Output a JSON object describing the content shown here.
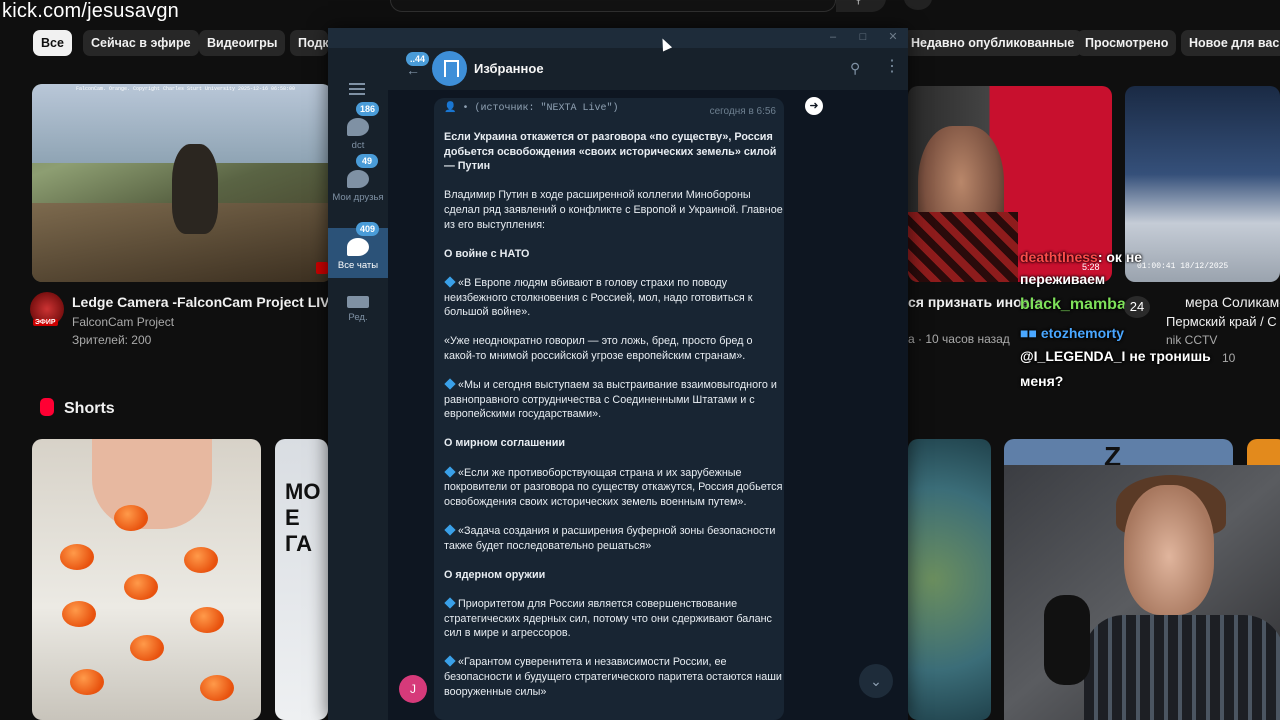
{
  "overlay_url": "kick.com/jesusavgn",
  "chips": [
    "Все",
    "Сейчас в эфире",
    "Видеоигры",
    "Подк",
    "Недавно опубликованные",
    "Просмотрено",
    "Новое для вас"
  ],
  "falcon_video": {
    "caption": "FalconCam. Orange. Copyright Charles Sturt University 2025-12-16 06:58:00",
    "title": "Ledge Camera -FalconCam Project LIVE",
    "channel": "FalconCam Project",
    "viewers": "Зрителей: 200",
    "live_badge": "ЭФИР"
  },
  "right_video_meta": "а · 10 часов назад",
  "right_video_title_frag": "ся признать иноаге",
  "snow_video": {
    "meta": "01:00:41 18/12/2025",
    "title": "мера Соликамс",
    "channel": "Пермский край / С",
    "cctv": "nik CCTV"
  },
  "shorts": {
    "heading": "Shorts",
    "short2_text": "MO\nE\nГА"
  },
  "stream_chat": {
    "line1_user": "deathtlness",
    "line1_text": "ок не",
    "time": "5:28",
    "line2": "переживаем",
    "line3_user": "black_mamba",
    "badge": "24",
    "line4_user": "etozhemorty",
    "line5": "@I_LEGENDA_I не тронишь",
    "line6": "меня?",
    "view_count": "10"
  },
  "telegram": {
    "folders": [
      {
        "label": "dct",
        "count": "186"
      },
      {
        "label": "Мои друзья",
        "count": "49"
      },
      {
        "label": "Все чаты",
        "count": "409"
      },
      {
        "label": "Ред.",
        "count": ""
      }
    ],
    "back_count": "44",
    "chat_title": "Избранное",
    "user_initial": "J",
    "message": {
      "source_line": "• (источник: \"NEXTA Live\")",
      "time": "сегодня в 6:56",
      "headline": "Если Украина откажется от разговора «по существу», Россия добьется освобождения «своих исторических земель» силой — Путин",
      "intro": "Владимир Путин в ходе расширенной коллегии Минобороны сделал ряд заявлений о конфликте с Европой и Украиной. Главное из его выступления:",
      "sec1": "О войне с НАТО",
      "q1": "«В Европе людям вбивают в голову страхи по поводу неизбежного столкновения с Россией, мол, надо готовиться к большой войне».",
      "q2": "«Уже неоднократно говорил — это ложь, бред, просто бред о какой-то мнимой российской угрозе европейским странам».",
      "q3": "«Мы и сегодня выступаем за выстраивание взаимовыгодного и равноправного сотрудничества с Соединенными Штатами и с европейскими государствами».",
      "sec2": "О мирном соглашении",
      "q4": "«Если же противоборствующая страна и их зарубежные покровители от разговора по существу откажутся, Россия добьется освобождения своих исторических земель военным путем».",
      "q5": "«Задача создания и расширения буферной зоны безопасности также будет последовательно решаться»",
      "sec3": "О ядерном оружии",
      "q6": "Приоритетом для России является совершенствование стратегических ядерных сил, потому что они сдерживают баланс сил в мире и агрессоров.",
      "q7": "«Гарантом суверенитета и независимости России, ее безопасности и будущего стратегического паритета остаются наши вооруженные силы»"
    }
  }
}
